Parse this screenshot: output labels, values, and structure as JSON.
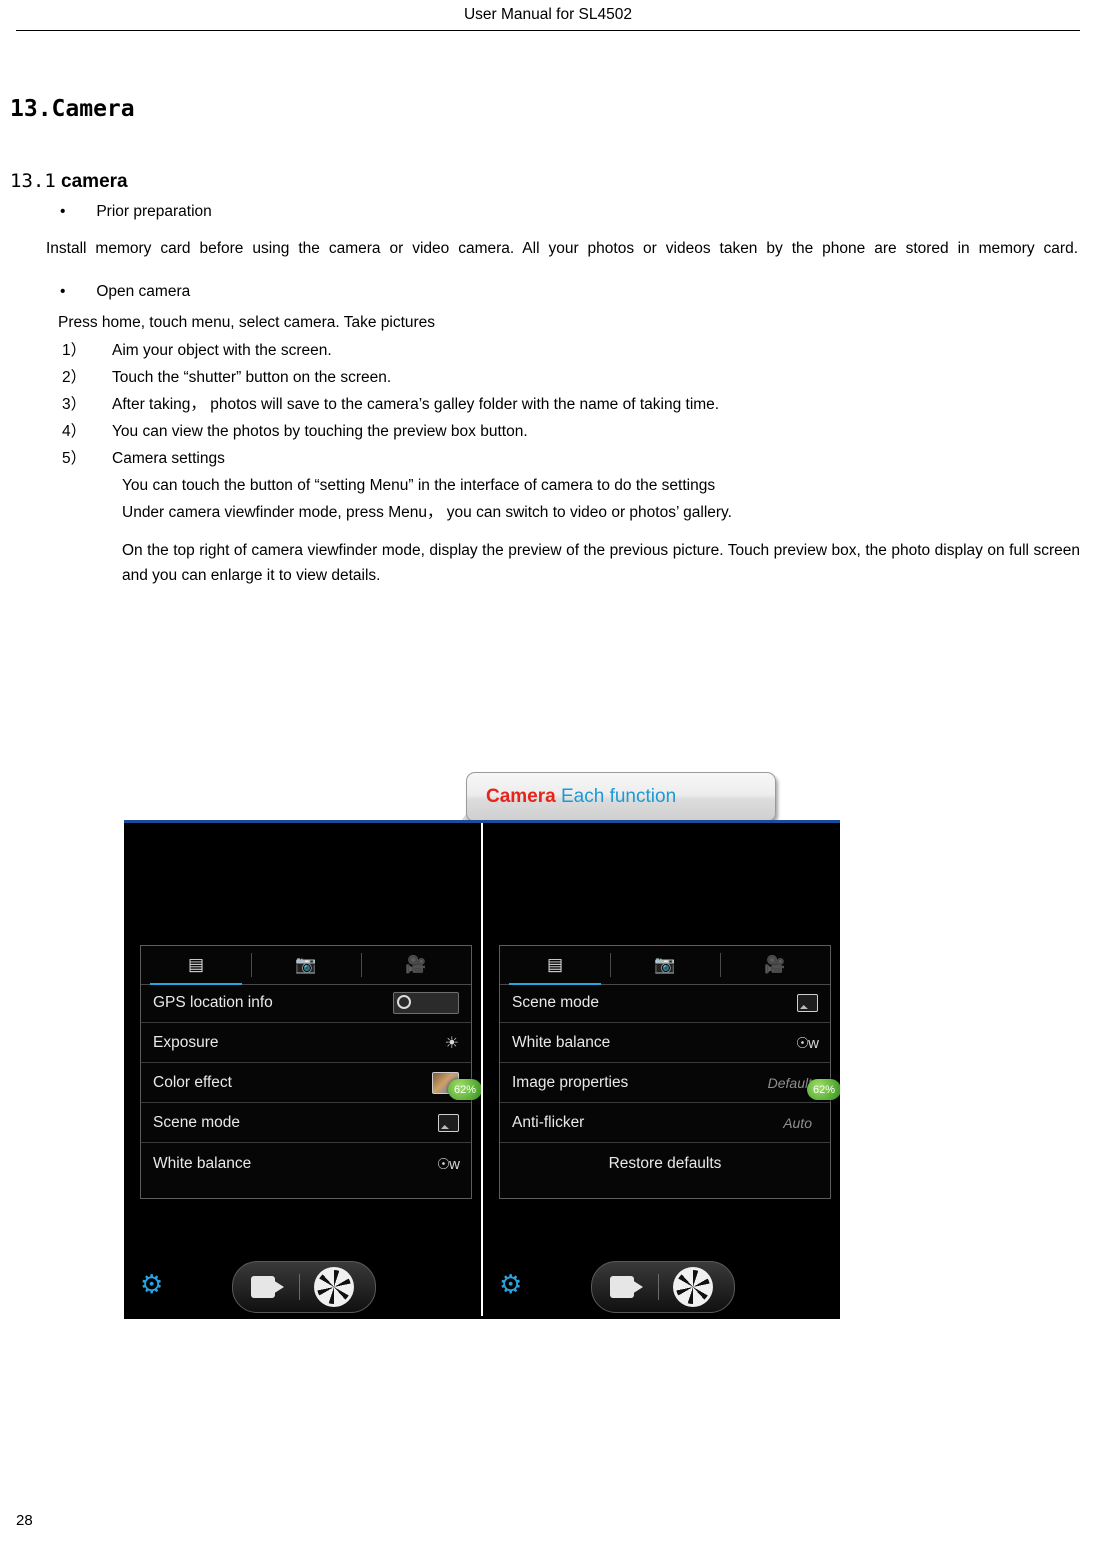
{
  "header": {
    "title": "User Manual for SL4502"
  },
  "page_number": "28",
  "section": {
    "number": "13.",
    "title": "Camera",
    "sub_number": "13.1",
    "sub_title": "camera"
  },
  "bullets": [
    {
      "label": "Prior preparation"
    },
    {
      "label": "Open camera"
    }
  ],
  "paragraphs": {
    "install": "Install memory card before using the camera or video camera. All your photos or videos taken by the phone are stored in memory card.",
    "press_home": "Press home, touch menu, select camera. Take pictures",
    "settings_1": "You can touch the button of “setting Menu” in the interface of camera to do the settings",
    "settings_2": "Under camera viewfinder mode, press Menu， you can switch to video or photos’ gallery.",
    "settings_3": "On the top right of camera viewfinder mode, display the preview of the previous picture. Touch preview box, the photo display on full screen and you can enlarge it to view details."
  },
  "numbered_steps": [
    {
      "num": "1）",
      "text": "Aim your object with the screen."
    },
    {
      "num": "2）",
      "text": "Touch the “shutter” button on the screen."
    },
    {
      "num": "3）",
      "text": "After taking， photos will save to the camera’s galley folder with the name of taking time."
    },
    {
      "num": "4）",
      "text": "You can view the photos by touching the preview box button."
    },
    {
      "num": "5）",
      "text": "Camera settings"
    }
  ],
  "callout": {
    "red_text": "Camera",
    "blue_text": " Each function"
  },
  "screenshot_left": {
    "tabs": [
      {
        "icon": "sliders-icon",
        "active": true
      },
      {
        "icon": "camera-icon",
        "active": false
      },
      {
        "icon": "video-icon",
        "active": false
      }
    ],
    "rows": [
      {
        "label": "GPS location info",
        "value": "",
        "control": "toggle"
      },
      {
        "label": "Exposure",
        "value": "",
        "control": "exposure-icon"
      },
      {
        "label": "Color effect",
        "value": "",
        "control": "thumbnail"
      },
      {
        "label": "Scene mode",
        "value": "",
        "control": "scene-icon"
      },
      {
        "label": "White balance",
        "value": "",
        "control": "wb-icon"
      }
    ],
    "battery": "62%"
  },
  "screenshot_right": {
    "tabs": [
      {
        "icon": "sliders-icon",
        "active": true
      },
      {
        "icon": "camera-icon",
        "active": false
      },
      {
        "icon": "video-icon",
        "active": false
      }
    ],
    "rows": [
      {
        "label": "Scene mode",
        "value": "",
        "control": "scene-icon"
      },
      {
        "label": "White balance",
        "value": "",
        "control": "wb-icon"
      },
      {
        "label": "Image properties",
        "value": "Default",
        "control": "none"
      },
      {
        "label": "Anti-flicker",
        "value": "Auto",
        "control": "none"
      },
      {
        "label": "Restore defaults",
        "value": "",
        "control": "none"
      }
    ],
    "battery": "62%"
  },
  "colors": {
    "accent_blue": "#29a3e0",
    "callout_red": "#e8241a",
    "callout_blue": "#1b9ad6",
    "frame_blue": "#1a4c9c"
  }
}
